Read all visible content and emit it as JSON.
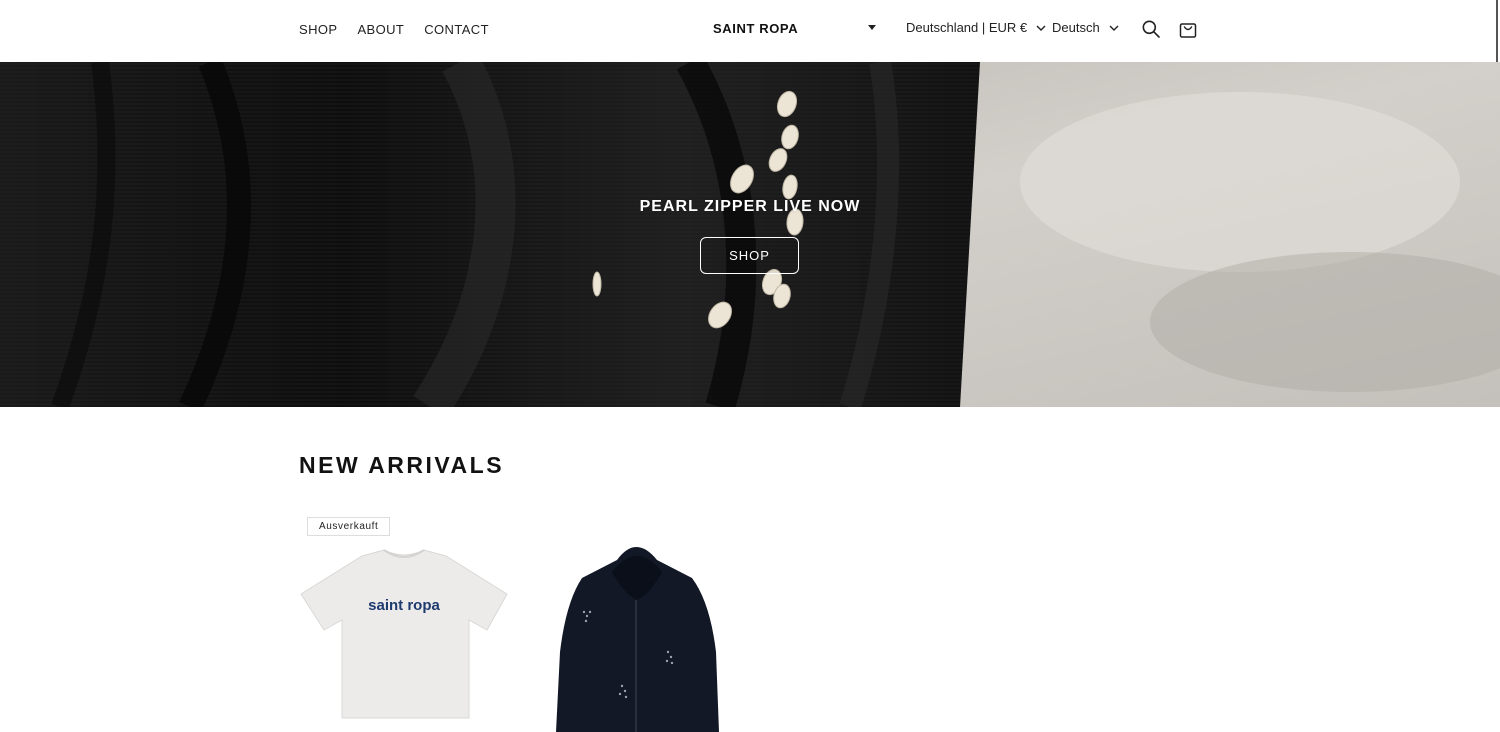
{
  "nav": {
    "items": [
      {
        "label": "SHOP"
      },
      {
        "label": "ABOUT"
      },
      {
        "label": "CONTACT"
      }
    ]
  },
  "brand": {
    "logo_text": "SAINT ROPA"
  },
  "localization": {
    "country": "Deutschland | EUR €",
    "language": "Deutsch"
  },
  "icons": {
    "search": "search-icon",
    "cart": "bag-icon"
  },
  "hero": {
    "title": "PEARL ZIPPER LIVE NOW",
    "button_label": "SHOP"
  },
  "collection": {
    "title": "NEW ARRIVALS",
    "products": [
      {
        "badge": "Ausverkauft",
        "print_text": "saint ropa"
      },
      {
        "badge": ""
      }
    ]
  },
  "colors": {
    "accent": "#121212",
    "background": "#ffffff",
    "print_navy": "#1e3a6e"
  }
}
